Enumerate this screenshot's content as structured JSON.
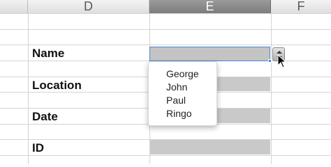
{
  "columns": {
    "left": "",
    "d": "D",
    "e": "E",
    "f": "F"
  },
  "labels": {
    "name": "Name",
    "location": "Location",
    "date": "Date",
    "id": "ID"
  },
  "dropdown": {
    "options": [
      "George",
      "John",
      "Paul",
      "Ringo"
    ]
  },
  "colors": {
    "selected_column_header": "#8a8a8a",
    "input_cell_fill": "#c9c9c9",
    "selection_border": "#4a86d4"
  }
}
